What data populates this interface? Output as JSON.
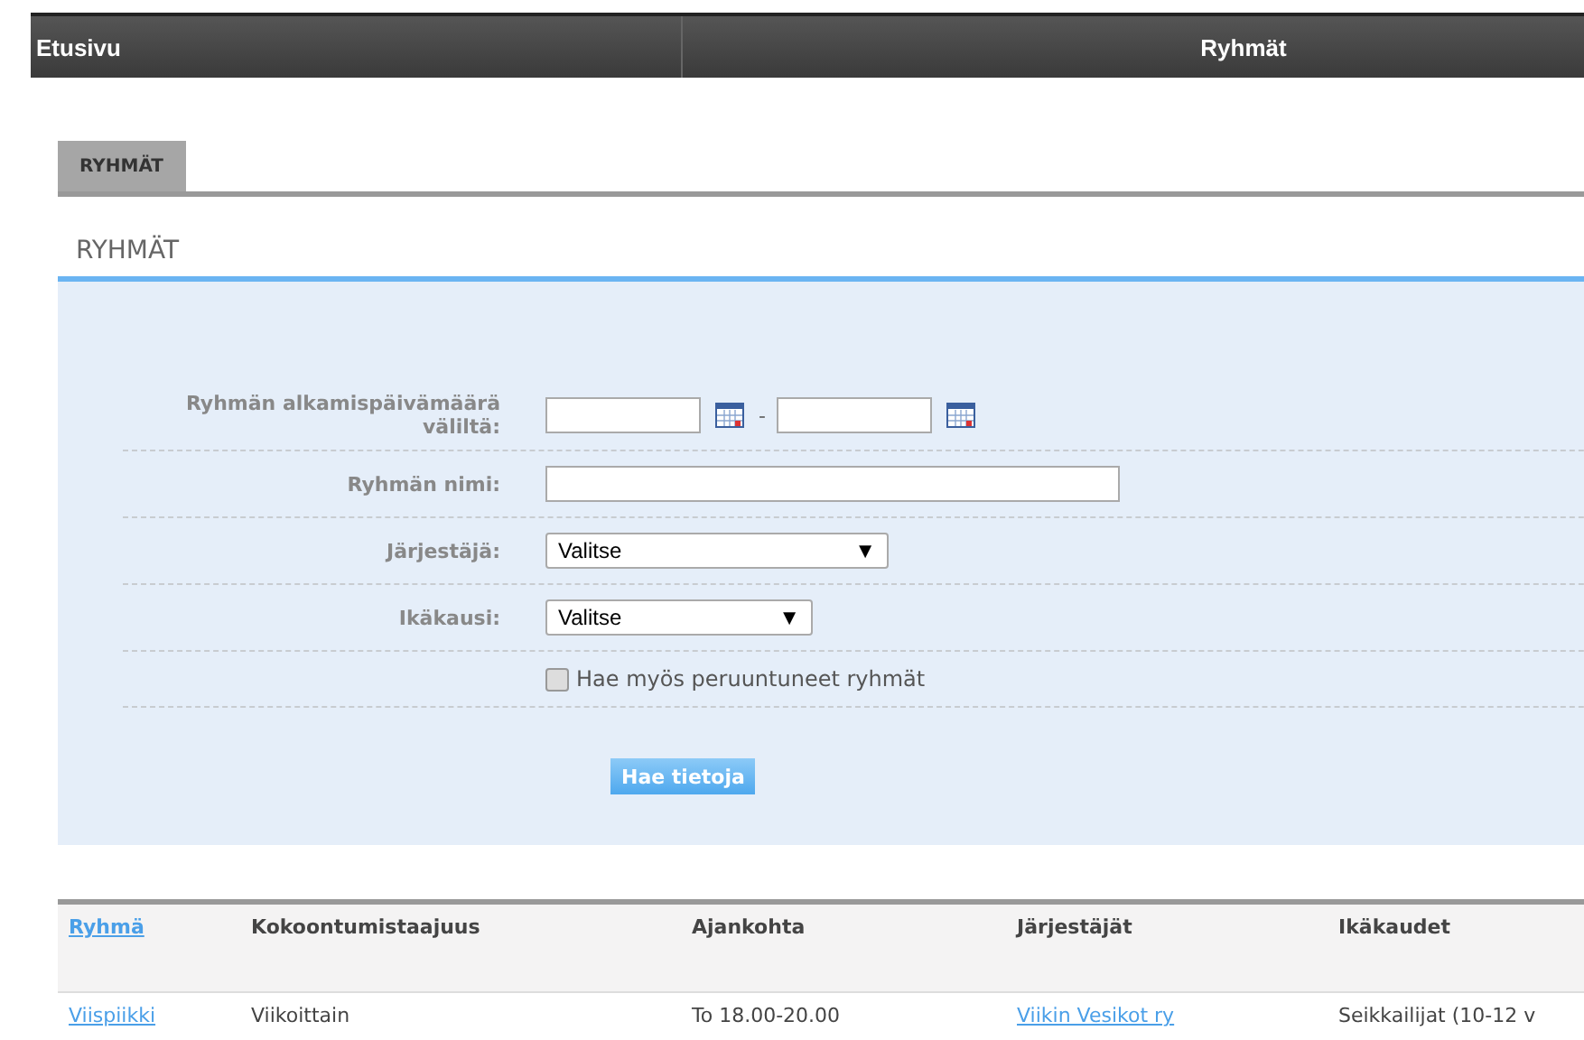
{
  "top_bar": {
    "home": "Etusivu",
    "title": "Ryhmät"
  },
  "tabs": [
    {
      "label": "RYHMÄT",
      "selected": true
    }
  ],
  "section_title": "RYHMÄT",
  "form": {
    "date_range": {
      "label": "Ryhmän alkamispäivämäärä väliltä:",
      "separator": "-"
    },
    "name": {
      "label": "Ryhmän nimi:"
    },
    "selects": [
      {
        "label": "Järjestäjä:",
        "value": "Valitse",
        "caret": "▼",
        "wide": true
      },
      {
        "label": "Ikäkausi:",
        "value": "Valitse",
        "caret": "▼",
        "wide": false
      }
    ],
    "checkbox": {
      "label": "Hae myös peruuntuneet ryhmät",
      "checked": false
    },
    "submit": "Hae tietoja"
  },
  "table": {
    "columns": [
      {
        "label": "Ryhmä",
        "link": true
      },
      {
        "label": "Kokoontumistaajuus",
        "link": false
      },
      {
        "label": "Ajankohta",
        "link": false
      },
      {
        "label": "Järjestäjät",
        "link": false
      },
      {
        "label": "Ikäkaudet",
        "link": false
      }
    ],
    "rows": [
      [
        {
          "text": "Viispiikki",
          "link": true
        },
        {
          "text": "Viikoittain",
          "link": false
        },
        {
          "text": "To 18.00-20.00",
          "link": false
        },
        {
          "text": "Viikin Vesikot ry",
          "link": true
        },
        {
          "text": "Seikkailijat (10-12 v",
          "link": false
        }
      ]
    ]
  }
}
